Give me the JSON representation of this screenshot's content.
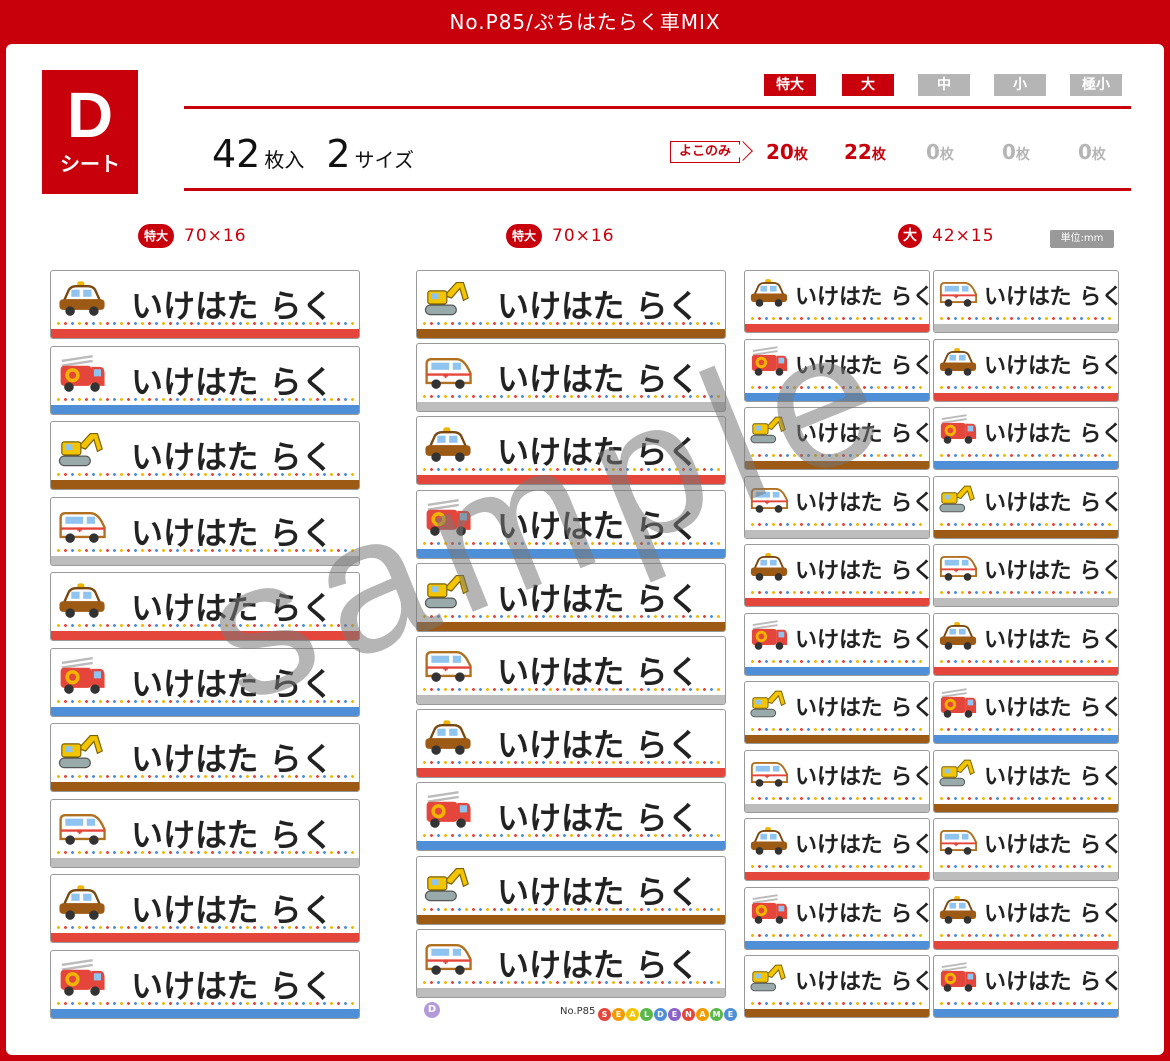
{
  "header": {
    "title": "No.P85/ぷちはたらく車MIX"
  },
  "sheet": {
    "letter": "D",
    "word": "シート"
  },
  "summary": {
    "count": "42",
    "count_unit": "枚入",
    "sizes": "2",
    "sizes_unit": "サイズ"
  },
  "size_tabs": [
    {
      "label": "特大",
      "color": "#c8000b"
    },
    {
      "label": "大",
      "color": "#c8000b"
    },
    {
      "label": "中",
      "color": "#b5b5b5"
    },
    {
      "label": "小",
      "color": "#b5b5b5"
    },
    {
      "label": "極小",
      "color": "#b5b5b5"
    }
  ],
  "orientation": {
    "label": "よこのみ"
  },
  "quantities": [
    {
      "num": "20",
      "unit": "枚",
      "color": "#c8000b"
    },
    {
      "num": "22",
      "unit": "枚",
      "color": "#c8000b"
    },
    {
      "num": "0",
      "unit": "枚",
      "color": "#b5b5b5"
    },
    {
      "num": "0",
      "unit": "枚",
      "color": "#b5b5b5"
    },
    {
      "num": "0",
      "unit": "枚",
      "color": "#b5b5b5"
    }
  ],
  "columns": [
    {
      "badge": "特大",
      "dims": "70×16"
    },
    {
      "badge": "特大",
      "dims": "70×16"
    },
    {
      "badge": "大",
      "dims": "42×15"
    }
  ],
  "unit_label": "単位:mm",
  "label_text": "いけはた らく",
  "col1_vehicles": [
    "police",
    "fire",
    "digger",
    "ambulance",
    "police",
    "fire",
    "digger",
    "ambulance",
    "police",
    "fire"
  ],
  "col2_vehicles": [
    "digger",
    "ambulance",
    "police",
    "fire",
    "digger",
    "ambulance",
    "police",
    "fire",
    "digger",
    "ambulance"
  ],
  "col3a_vehicles": [
    "police",
    "fire",
    "digger",
    "ambulance",
    "police",
    "fire",
    "digger",
    "ambulance",
    "police",
    "fire",
    "digger"
  ],
  "col3b_vehicles": [
    "ambulance",
    "police",
    "fire",
    "digger",
    "ambulance",
    "police",
    "fire",
    "digger",
    "ambulance",
    "police",
    "fire"
  ],
  "band_colors": {
    "police": "#e5463b",
    "fire": "#4e8fd8",
    "digger": "#9c5a14",
    "ambulance": "#bdbdbd"
  },
  "watermark": "sample",
  "footer": {
    "badge": "D",
    "number": "No.P85",
    "logo": [
      "S",
      "E",
      "A",
      "L",
      "D",
      "E",
      "N",
      "A",
      "M",
      "E"
    ]
  }
}
